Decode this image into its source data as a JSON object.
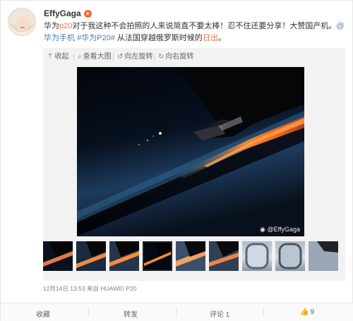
{
  "post": {
    "username": "EffyGaga",
    "badge_icon": "vip-badge",
    "text_1": "华为",
    "text_2": "p20",
    "text_3": "对于我这种不会拍照的人来说简直不要太棒！忍不住还要分享！大赞国产机。",
    "mention": "@华为手机",
    "hashtag": "#华为P20#",
    "text_4": " 从法国穿越俄罗斯时候的",
    "text_5": "日出",
    "text_6": "。",
    "timestamp": "12月14日 13:53",
    "source_prefix": "来自",
    "source": "HUAWEI P20"
  },
  "media_toolbar": {
    "collapse": "收起",
    "view_large": "查看大图",
    "rotate_left": "向左旋转",
    "rotate_right": "向右旋转"
  },
  "photo": {
    "watermark": "@EffyGaga"
  },
  "thumbnails": {
    "count": 9,
    "active_index": 3
  },
  "actions": {
    "favorite": "收藏",
    "repost": "转发",
    "comment": "评论 1",
    "like": "9"
  },
  "colors": {
    "highlight": "#eb7350",
    "link": "#507daf",
    "text": "#333333"
  }
}
